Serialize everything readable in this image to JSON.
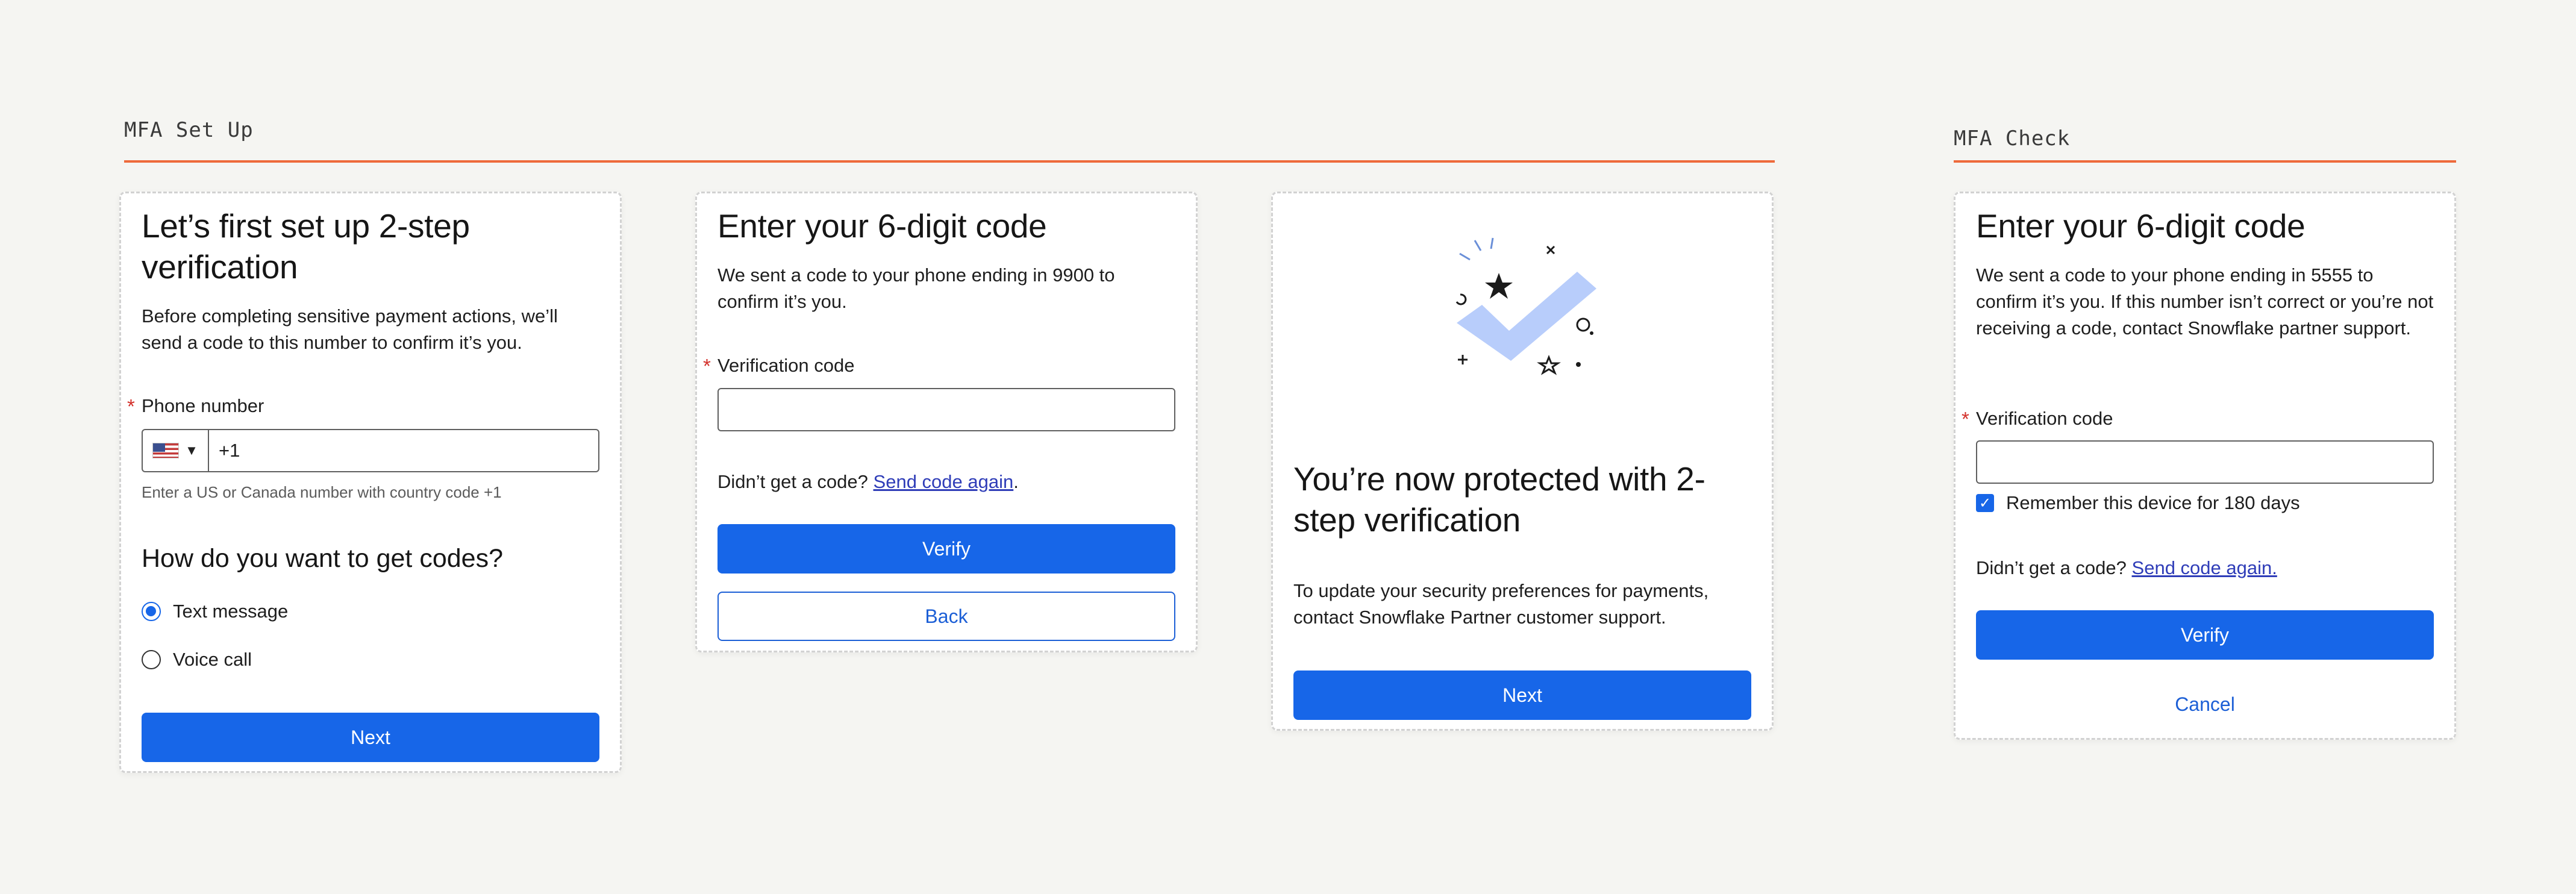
{
  "sections": {
    "setup": "MFA Set Up",
    "check": "MFA Check"
  },
  "setup_card": {
    "title": "Let’s first set up 2-step verification",
    "description": "Before completing sensitive payment actions, we’ll send a code to this number to confirm it’s you.",
    "phone_label": "Phone number",
    "phone_value": "+1",
    "phone_hint": "Enter a US or Canada number with country code +1",
    "codes_heading": "How do you want to get codes?",
    "option_text": "Text message",
    "option_voice": "Voice call",
    "next_label": "Next"
  },
  "code_card": {
    "title": "Enter your 6-digit code",
    "description": "We sent a code to your phone ending in 9900 to confirm it’s you.",
    "code_label": "Verification code",
    "code_value": "",
    "resend_prompt": "Didn’t get a code?",
    "resend_link": "Send code again",
    "resend_suffix": ".",
    "verify_label": "Verify",
    "back_label": "Back"
  },
  "success_card": {
    "title": "You’re now protected with 2-step verification",
    "description": "To update your security preferences for payments, contact Snowflake Partner customer support.",
    "next_label": "Next"
  },
  "check_card": {
    "title": "Enter your 6-digit code",
    "description": "We sent a code to your phone ending in 5555 to confirm it’s you. If this number isn’t correct or you’re not receiving a code, contact Snowflake partner support.",
    "code_label": "Verification code",
    "code_value": "",
    "remember_label": "Remember this device for 180 days",
    "remember_checked": true,
    "resend_prompt": "Didn’t get a code?",
    "resend_link": "Send code again.",
    "verify_label": "Verify",
    "cancel_label": "Cancel"
  },
  "colors": {
    "accent": "#1766e8",
    "section_rule": "#ee6a3c",
    "required": "#d3302a",
    "link": "#2f3db8",
    "illustration_check": "#b8cdfb"
  },
  "icons": {
    "country_flag": "us-flag-icon",
    "country_dropdown": "caret-down-icon",
    "success_illustration": "checkmark-illustration"
  }
}
